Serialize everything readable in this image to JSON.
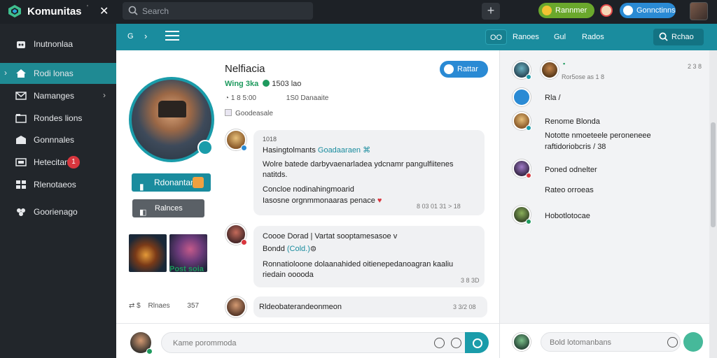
{
  "app": {
    "title": "Komunitas",
    "version_mark": "'"
  },
  "topbar": {
    "search_placeholder": "Search",
    "add_label": "+",
    "pill_green_label": "Rannmer",
    "pill_blue_label": "Gonnctinns"
  },
  "sidebar": {
    "header": "Inutnonlaa",
    "items": [
      {
        "label": "Rodi lonas",
        "active": true,
        "caret_left": "›"
      },
      {
        "label": "Namanges",
        "caret": "›"
      },
      {
        "label": "Rondes lions"
      },
      {
        "label": "Gonnnales"
      },
      {
        "label": "Hetecitan",
        "badge": "1"
      },
      {
        "label": "Rlenotaeos"
      },
      {
        "label": "Goorienago"
      }
    ]
  },
  "main_header": {
    "icon_text": "G",
    "caret": "›",
    "btn_box_label": "OO",
    "link1": "Ranoes",
    "link2": "Gul",
    "link3": "Rados",
    "follow_label": "Rchao"
  },
  "profile": {
    "btn_primary": "Rdonantan",
    "btn_secondary": "Ralnces",
    "thumb_caption": "Post soia",
    "footer_left": "Rlnaes",
    "footer_right": "357"
  },
  "feed": {
    "title": "Nelfiacia",
    "stat1": "Wing 3ka",
    "stat2": "1503 lao",
    "meta1": "1 8 5:00",
    "meta2": "1S0 Danaaite",
    "category": "Goodeasale",
    "follow_label": "Rattar",
    "posts": [
      {
        "header": "1018",
        "title_a": "Hasingtolmants",
        "title_b": "Goadaaraen",
        "body1": "Wolre batede darbyvaenarladea ydcnamr pangulfiitenes",
        "body2": "natitds.",
        "body3": "Concloe nodinahingmoarid",
        "body4": "Iasosne orgnmmonaaras penace",
        "time": "8 03 01 31 > 18"
      },
      {
        "title": "Coooe Dorad | Vartat sooptamesasoe v",
        "title2a": "Bondd",
        "title2b": "(Cold.)",
        "body1": "Ronnatioloone dolaanahided oitienepedanoagran kaaliu",
        "body2": "riedain ooooda",
        "time": "3 8 3D"
      },
      {
        "title": "Rldeobaterandeonmeon",
        "time": "3 3/2 08"
      }
    ]
  },
  "composer": {
    "placeholder": "Kame porommoda"
  },
  "right_panel": {
    "header_time": "2 3 8",
    "header_sub": "Ror5ose as 1 8",
    "items": [
      {
        "title": "Rla /"
      },
      {
        "title": "Renome Blonda",
        "line2": "Nototte nmoeteele peroneneee",
        "line3": "raftidoriobcris / 38"
      },
      {
        "title": "Poned odnelter",
        "line2": "Rateo orroeas"
      },
      {
        "title": "Hobotlotocae"
      }
    ],
    "composer_placeholder": "Bold lotomanbans"
  },
  "colors": {
    "teal": "#1a8c9e",
    "topbar": "#1d2126",
    "sidebar": "#22262b",
    "accent_blue": "#2a8ad4",
    "green": "#6aa82c"
  }
}
